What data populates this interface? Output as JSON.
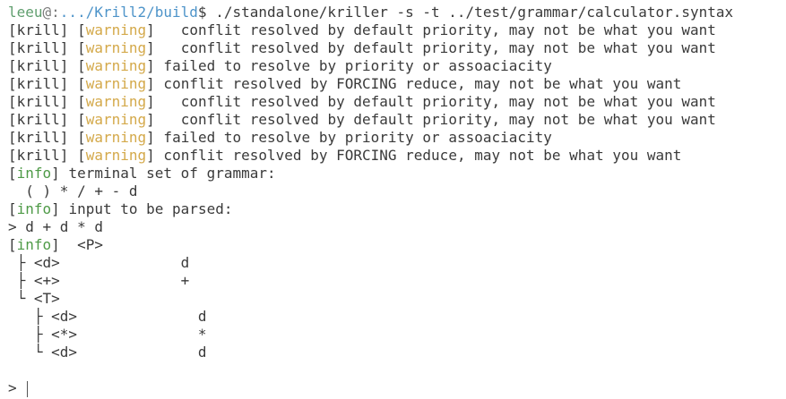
{
  "prompt": {
    "user": "leeu",
    "at": "@:",
    "path": ".../Krill2/build",
    "dollar": "$",
    "command": " ./standalone/kriller -s -t ../test/grammar/calculator.syntax"
  },
  "tags": {
    "krill": "[krill]",
    "warning_open": "[",
    "warning": "warning",
    "warning_close": "]",
    "info_open": "[",
    "info": "info",
    "info_close": "]"
  },
  "warnings": [
    "   conflit resolved by default priority, may not be what you want",
    "   conflit resolved by default priority, may not be what you want",
    " failed to resolve by priority or assoaciacity",
    " conflit resolved by FORCING reduce, may not be what you want",
    "   conflit resolved by default priority, may not be what you want",
    "   conflit resolved by default priority, may not be what you want",
    " failed to resolve by priority or assoaciacity",
    " conflit resolved by FORCING reduce, may not be what you want"
  ],
  "info1": " terminal set of grammar:",
  "terminals": "  ( ) * / + - d",
  "info2": " input to be parsed:",
  "input_line": "> d + d * d",
  "info3": "  <P>",
  "tree": [
    " ├ <d>              d",
    " ├ <+>              +",
    " └ <T>",
    "   ├ <d>              d",
    "   ├ <*>              *",
    "   └ <d>              d"
  ],
  "final_prompt": "> "
}
